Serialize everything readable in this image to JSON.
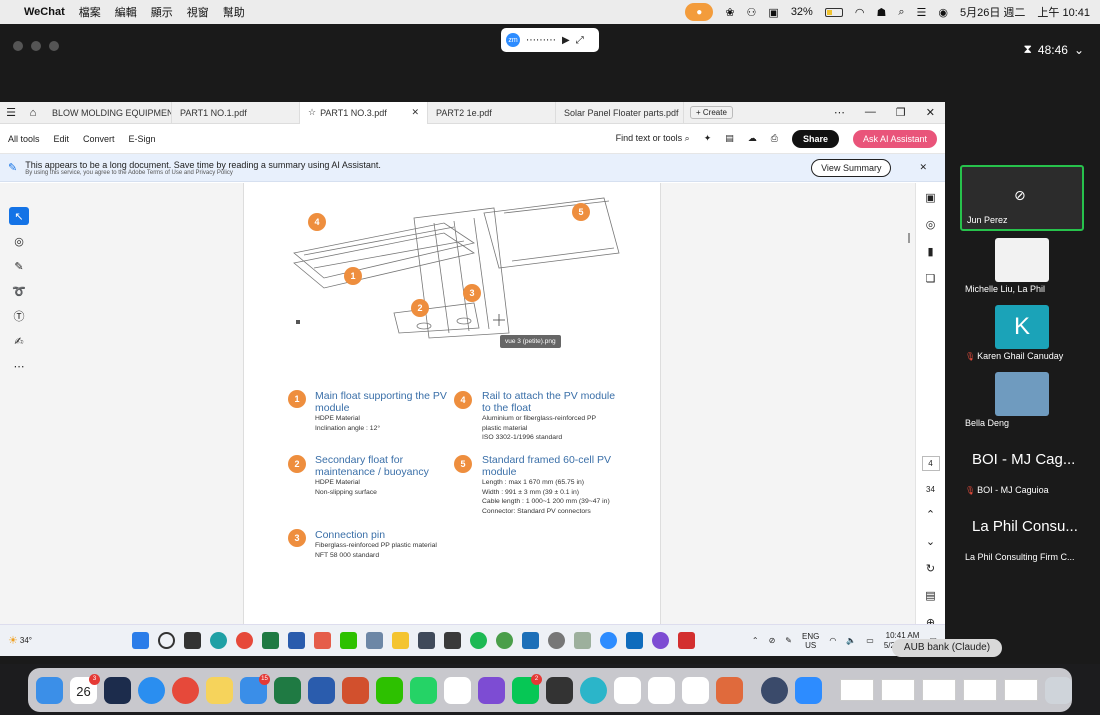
{
  "menubar": {
    "app": "WeChat",
    "items": [
      "檔案",
      "編輯",
      "顯示",
      "視窗",
      "幫助"
    ],
    "battery": "32%",
    "date": "5月26日 週二",
    "time": "上午 10:41"
  },
  "zoom": {
    "pill_label": "zm",
    "timer": "48:46"
  },
  "acrobat": {
    "tabs": [
      {
        "label": "BLOW MOLDING EQUIPMENT P..."
      },
      {
        "label": "PART1 NO.1.pdf"
      },
      {
        "label": "PART1 NO.3.pdf"
      },
      {
        "label": "PART2 1e.pdf"
      },
      {
        "label": "Solar Panel Floater parts.pdf"
      }
    ],
    "create_label": "Create",
    "menu": [
      "All tools",
      "Edit",
      "Convert",
      "E-Sign"
    ],
    "find_label": "Find text or tools",
    "share_label": "Share",
    "ai_label": "Ask AI Assistant",
    "banner_text": "This appears to be a long document. Save time by reading a summary using AI Assistant.",
    "banner_small": "By using this service, you agree to the Adobe Terms of Use and Privacy Policy",
    "view_summary": "View Summary",
    "page_current": "4",
    "page_total": "34",
    "tooltip": "vue 3 (petite).png"
  },
  "legend": [
    {
      "num": "1",
      "title": "Main float supporting the PV module",
      "lines": [
        "HDPE Material",
        "Inclination angle : 12°"
      ]
    },
    {
      "num": "2",
      "title": "Secondary float for maintenance / buoyancy",
      "lines": [
        "HDPE Material",
        "Non-slipping surface"
      ]
    },
    {
      "num": "3",
      "title": "Connection pin",
      "lines": [
        "Fiberglass-reinforced PP plastic material",
        "NFT 58 000 standard"
      ]
    },
    {
      "num": "4",
      "title": "Rail to attach the PV module to the float",
      "lines": [
        "Aluminium or fiberglass-reinforced PP",
        "plastic material",
        "ISO 3302-1/1996 standard"
      ]
    },
    {
      "num": "5",
      "title": "Standard framed 60-cell PV module",
      "lines": [
        "Length : max 1 670 mm (65.75 in)",
        "Width : 991 ± 3 mm (39 ± 0.1 in)",
        "Cable length : 1 000~1 200 mm (39~47 in)",
        "Connector: Standard PV connectors"
      ]
    }
  ],
  "taskbar": {
    "weather": "34°",
    "lang1": "ENG",
    "lang2": "US",
    "time": "10:41 AM",
    "date": "5/26/2026"
  },
  "participants": [
    {
      "name": "Jun Perez",
      "muted": false,
      "active": true,
      "video_off": true
    },
    {
      "name": "Michelle Liu, La Phil",
      "muted": false
    },
    {
      "name": "Karen Ghail Canuday",
      "muted": true,
      "initial": "K"
    },
    {
      "name": "Bella Deng",
      "muted": false
    },
    {
      "name": "BOI - MJ Caguioa",
      "muted": true,
      "big": "BOI - MJ Cag..."
    },
    {
      "name": "La Phil Consulting Firm C...",
      "muted": false,
      "big": "La Phil Consu..."
    }
  ],
  "dock": {
    "calendar_day": "26",
    "calendar_badge": "3",
    "mail_badge": "15",
    "line_badge": "2",
    "tooltip": "AUB bank (Claude)"
  },
  "colors": {
    "accent_orange": "#ee8e3e",
    "title_blue": "#3a6fa8",
    "active_green": "#27c24c",
    "acrobat_blue": "#1473e6",
    "ai_pink": "#e9547a"
  }
}
